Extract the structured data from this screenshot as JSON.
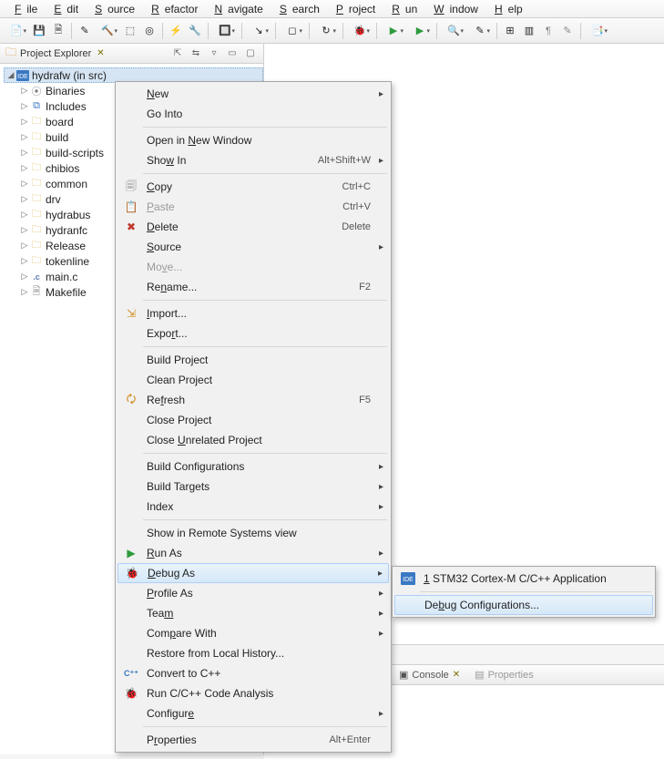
{
  "menubar": [
    "File",
    "Edit",
    "Source",
    "Refactor",
    "Navigate",
    "Search",
    "Project",
    "Run",
    "Window",
    "Help"
  ],
  "pane": {
    "title": "Project Explorer"
  },
  "tree": {
    "root": {
      "label": "hydrafw (in src)",
      "expanded": true
    },
    "children": [
      {
        "label": "Binaries",
        "icon": "binaries"
      },
      {
        "label": "Includes",
        "icon": "includes"
      },
      {
        "label": "board",
        "icon": "folder"
      },
      {
        "label": "build",
        "icon": "folder"
      },
      {
        "label": "build-scripts",
        "icon": "folder-src"
      },
      {
        "label": "chibios",
        "icon": "folder"
      },
      {
        "label": "common",
        "icon": "folder-src"
      },
      {
        "label": "drv",
        "icon": "folder-src"
      },
      {
        "label": "hydrabus",
        "icon": "folder-src"
      },
      {
        "label": "hydranfc",
        "icon": "folder-src"
      },
      {
        "label": "Release",
        "icon": "folder"
      },
      {
        "label": "tokenline",
        "icon": "folder"
      },
      {
        "label": "main.c",
        "icon": "cfile"
      },
      {
        "label": "Makefile",
        "icon": "makefile"
      }
    ]
  },
  "context_menu": [
    {
      "label": "New",
      "u": 0,
      "submenu": true
    },
    {
      "label": "Go Into"
    },
    {
      "sep": true
    },
    {
      "label": "Open in New Window",
      "u": 8
    },
    {
      "label": "Show In",
      "u": 3,
      "accel": "Alt+Shift+W",
      "submenu": true
    },
    {
      "sep": true
    },
    {
      "label": "Copy",
      "u": 0,
      "accel": "Ctrl+C",
      "icon": "copy"
    },
    {
      "label": "Paste",
      "u": 0,
      "accel": "Ctrl+V",
      "icon": "paste",
      "disabled": true
    },
    {
      "label": "Delete",
      "u": 0,
      "accel": "Delete",
      "icon": "delete"
    },
    {
      "label": "Source",
      "u": 0,
      "submenu": true
    },
    {
      "label": "Move...",
      "u": 2,
      "disabled": true
    },
    {
      "label": "Rename...",
      "u": 2,
      "accel": "F2"
    },
    {
      "sep": true
    },
    {
      "label": "Import...",
      "u": 0,
      "icon": "import"
    },
    {
      "label": "Export...",
      "u": 4
    },
    {
      "sep": true
    },
    {
      "label": "Build Project"
    },
    {
      "label": "Clean Project"
    },
    {
      "label": "Refresh",
      "u": 2,
      "accel": "F5",
      "icon": "refresh"
    },
    {
      "label": "Close Project"
    },
    {
      "label": "Close Unrelated Project",
      "u": 6
    },
    {
      "sep": true
    },
    {
      "label": "Build Configurations",
      "submenu": true
    },
    {
      "label": "Build Targets",
      "submenu": true
    },
    {
      "label": "Index",
      "submenu": true
    },
    {
      "sep": true
    },
    {
      "label": "Show in Remote Systems view"
    },
    {
      "label": "Run As",
      "u": 0,
      "submenu": true,
      "icon": "run"
    },
    {
      "label": "Debug As",
      "u": 0,
      "submenu": true,
      "icon": "debug",
      "selected": true
    },
    {
      "label": "Profile As",
      "u": 0,
      "submenu": true
    },
    {
      "label": "Team",
      "u": 3,
      "submenu": true
    },
    {
      "label": "Compare With",
      "u": 3,
      "submenu": true
    },
    {
      "label": "Restore from Local History..."
    },
    {
      "label": "Convert to C++",
      "icon": "cpp"
    },
    {
      "label": "Run C/C++ Code Analysis",
      "icon": "analysis"
    },
    {
      "label": "Configure",
      "u": 8,
      "submenu": true
    },
    {
      "sep": true
    },
    {
      "label": "Properties",
      "u": 1,
      "accel": "Alt+Enter"
    }
  ],
  "submenu_debug": [
    {
      "label": "1 STM32 Cortex-M C/C++ Application",
      "u": 0,
      "icon": "ide"
    },
    {
      "sep": true
    },
    {
      "label": "Debug Configurations...",
      "u": 2,
      "selected": true
    }
  ],
  "bottom": {
    "console": "Console",
    "properties": "Properties"
  }
}
